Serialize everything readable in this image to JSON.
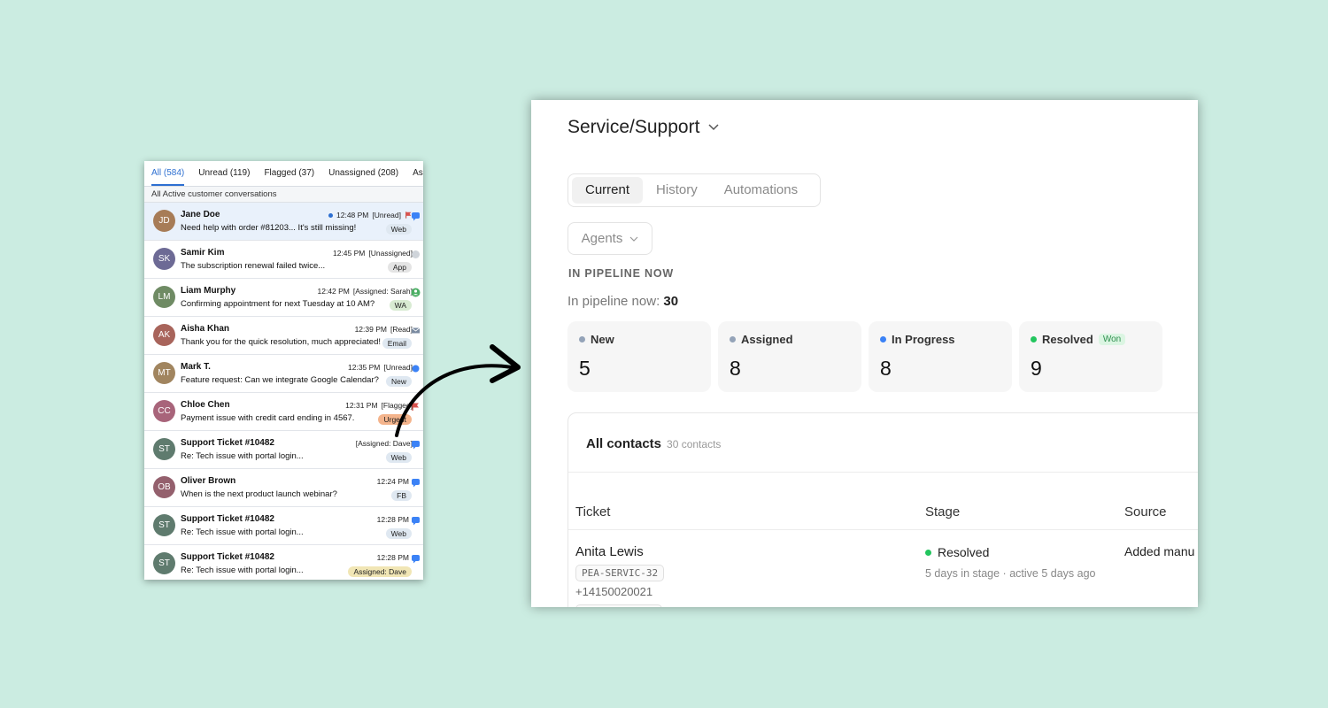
{
  "inbox": {
    "tabs": [
      "All (584)",
      "Unread (119)",
      "Flagged (37)",
      "Unassigned (208)",
      "Assigned"
    ],
    "subheader": "All Active customer conversations",
    "rows": [
      {
        "initials": "JD",
        "name": "Jane Doe",
        "time": "12:48 PM",
        "status": "[Unread]",
        "message": "Need help with order #81203... It's still missing!",
        "badge": "Web",
        "avatar_color": "#a77c57",
        "selected": true,
        "icon": "chat-bubble-icon",
        "flag": true
      },
      {
        "initials": "SK",
        "name": "Samir Kim",
        "time": "12:45 PM",
        "status": "[Unassigned]",
        "message": "The subscription renewal failed twice...",
        "badge": "App",
        "avatar_color": "#6d6a95",
        "icon": "gray-dot-icon"
      },
      {
        "initials": "LM",
        "name": "Liam Murphy",
        "time": "12:42 PM",
        "status": "[Assigned: Sarah]",
        "message": "Confirming appointment for next Tuesday at 10 AM?",
        "badge": "WA",
        "avatar_color": "#6f8b64",
        "icon": "user-icon"
      },
      {
        "initials": "AK",
        "name": "Aisha Khan",
        "time": "12:39 PM",
        "status": "[Read]",
        "message": "Thank you for the quick resolution, much appreciated!",
        "badge": "Email",
        "avatar_color": "#a8645b",
        "icon": "mail-icon"
      },
      {
        "initials": "MT",
        "name": "Mark T.",
        "time": "12:35 PM",
        "status": "[Unread]",
        "message": "Feature request: Can we integrate Google Calendar?",
        "badge": "New",
        "avatar_color": "#a1855f",
        "icon": "blue-dot-icon"
      },
      {
        "initials": "CC",
        "name": "Chloe Chen",
        "time": "12:31 PM",
        "status": "[Flagged]",
        "message": "Payment issue with credit card ending in 4567.",
        "badge": "Urgent",
        "avatar_color": "#a8647a",
        "icon": "flag-icon"
      },
      {
        "initials": "ST",
        "name": "Support Ticket #10482",
        "time": "",
        "status": "[Assigned: Dave]",
        "message": "Re: Tech issue with portal login...",
        "badge": "Web",
        "avatar_color": "#5f7b6e",
        "icon": "chat-bubble-icon"
      },
      {
        "initials": "OB",
        "name": "Oliver Brown",
        "time": "12:24 PM",
        "status": "",
        "message": "When is the next product launch webinar?",
        "badge": "FB",
        "avatar_color": "#94606d",
        "icon": "chat-bubble-icon"
      },
      {
        "initials": "ST",
        "name": "Support Ticket #10482",
        "time": "12:28 PM",
        "status": "",
        "message": "Re: Tech issue with portal login...",
        "badge": "Web",
        "avatar_color": "#5f7b6e",
        "icon": "chat-bubble-icon"
      },
      {
        "initials": "ST",
        "name": "Support Ticket #10482",
        "time": "12:28 PM",
        "status": "",
        "message": "Re: Tech issue with portal login...",
        "badge": "Assigned: Dave",
        "avatar_color": "#5f7b6e",
        "icon": "chat-bubble-icon"
      }
    ],
    "badge_colors": {
      "Web": "#dfe8f1",
      "App": "#e4e4e4",
      "WA": "#d8ebd2",
      "Email": "#dfe8f1",
      "New": "#dfe8f1",
      "Urgent": "#f4b48c",
      "FB": "#dfe8f1",
      "Assigned: Dave": "#f1e6b5"
    }
  },
  "panel": {
    "title": "Service/Support",
    "segments": [
      "Current",
      "History",
      "Automations"
    ],
    "active_segment": "Current",
    "agents_filter": "Agents",
    "pipeline_label": "IN PIPELINE NOW",
    "pipeline_text": "In pipeline now: ",
    "pipeline_count": "30",
    "stages": [
      {
        "label": "New",
        "value": "5",
        "color": "#94a3b8"
      },
      {
        "label": "Assigned",
        "value": "8",
        "color": "#94a3b8"
      },
      {
        "label": "In Progress",
        "value": "8",
        "color": "#3b82f6"
      },
      {
        "label": "Resolved",
        "value": "9",
        "color": "#22c55e",
        "tag": "Won"
      }
    ],
    "contacts": {
      "title": "All contacts",
      "count": "30 contacts",
      "columns": [
        "Ticket",
        "Stage",
        "Source"
      ],
      "row": {
        "name": "Anita Lewis",
        "code": "PEA-SERVIC-32",
        "phone": "+14150020021",
        "stage": "Resolved",
        "stage_meta": "5 days in stage · active 5 days ago",
        "source": "Added manu"
      }
    }
  }
}
